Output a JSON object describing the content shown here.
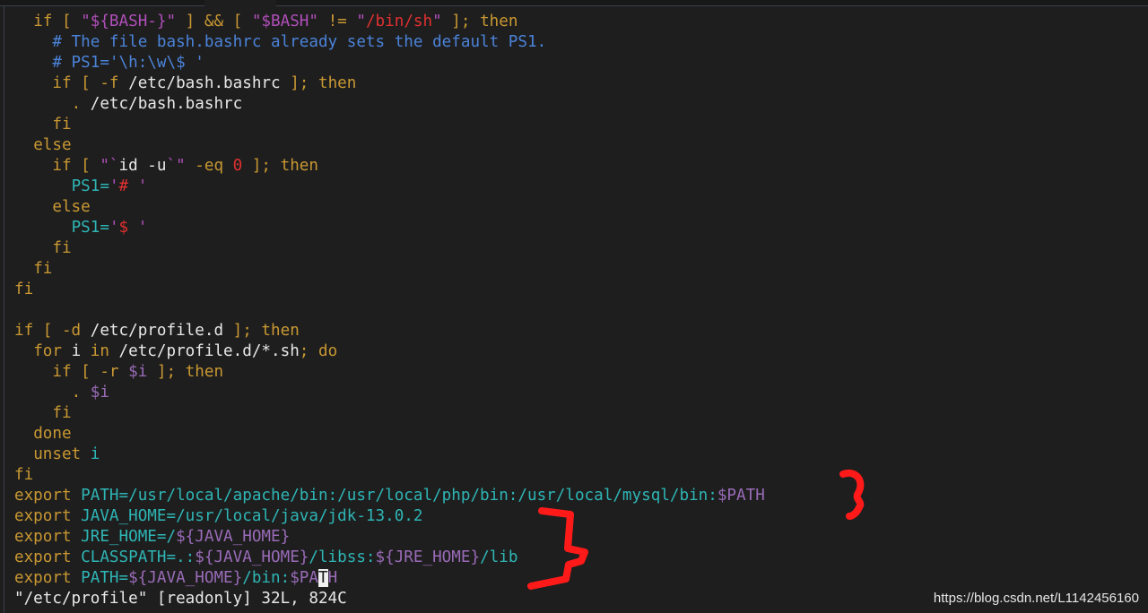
{
  "editor": {
    "lines": [
      [
        {
          "t": "  "
        },
        {
          "c": "kw",
          "t": "if [ "
        },
        {
          "c": "str",
          "t": "\"${BASH-}\""
        },
        {
          "c": "kw",
          "t": " ] && [ "
        },
        {
          "c": "str",
          "t": "\"$BASH\""
        },
        {
          "c": "kw",
          "t": " != "
        },
        {
          "c": "str",
          "t": "\""
        },
        {
          "c": "red",
          "t": "/bin/sh"
        },
        {
          "c": "str",
          "t": "\""
        },
        {
          "c": "kw",
          "t": " ]; then"
        }
      ],
      [
        {
          "t": "    "
        },
        {
          "c": "cmt",
          "t": "# The file bash.bashrc already sets the default PS1."
        }
      ],
      [
        {
          "t": "    "
        },
        {
          "c": "cmt",
          "t": "# PS1='\\h:\\w\\$ '"
        }
      ],
      [
        {
          "t": "    "
        },
        {
          "c": "kw",
          "t": "if [ -f "
        },
        {
          "c": "wh",
          "t": "/etc/bash.bashrc"
        },
        {
          "c": "kw",
          "t": " ]; then"
        }
      ],
      [
        {
          "t": "      "
        },
        {
          "c": "kw",
          "t": ". "
        },
        {
          "c": "wh",
          "t": "/etc/bash.bashrc"
        }
      ],
      [
        {
          "t": "    "
        },
        {
          "c": "kw",
          "t": "fi"
        }
      ],
      [
        {
          "t": "  "
        },
        {
          "c": "kw",
          "t": "else"
        }
      ],
      [
        {
          "t": "    "
        },
        {
          "c": "kw",
          "t": "if [ "
        },
        {
          "c": "str",
          "t": "\"`"
        },
        {
          "c": "wh",
          "t": "id -u"
        },
        {
          "c": "str",
          "t": "`\""
        },
        {
          "c": "kw",
          "t": " -eq "
        },
        {
          "c": "red",
          "t": "0"
        },
        {
          "c": "kw",
          "t": " ]; then"
        }
      ],
      [
        {
          "t": "      "
        },
        {
          "c": "cy",
          "t": "PS1="
        },
        {
          "c": "str",
          "t": "'"
        },
        {
          "c": "red",
          "t": "#"
        },
        {
          "c": "str",
          "t": " '"
        }
      ],
      [
        {
          "t": "    "
        },
        {
          "c": "kw",
          "t": "else"
        }
      ],
      [
        {
          "t": "      "
        },
        {
          "c": "cy",
          "t": "PS1="
        },
        {
          "c": "str",
          "t": "'"
        },
        {
          "c": "red",
          "t": "$"
        },
        {
          "c": "str",
          "t": " '"
        }
      ],
      [
        {
          "t": "    "
        },
        {
          "c": "kw",
          "t": "fi"
        }
      ],
      [
        {
          "t": "  "
        },
        {
          "c": "kw",
          "t": "fi"
        }
      ],
      [
        {
          "c": "kw",
          "t": "fi"
        }
      ],
      [],
      [
        {
          "c": "kw",
          "t": "if [ -d "
        },
        {
          "c": "wh",
          "t": "/etc/profile.d"
        },
        {
          "c": "kw",
          "t": " ]; then"
        }
      ],
      [
        {
          "t": "  "
        },
        {
          "c": "kw",
          "t": "for "
        },
        {
          "c": "wh",
          "t": "i"
        },
        {
          "c": "kw",
          "t": " in "
        },
        {
          "c": "wh",
          "t": "/etc/profile.d/*.sh"
        },
        {
          "c": "kw",
          "t": "; do"
        }
      ],
      [
        {
          "t": "    "
        },
        {
          "c": "kw",
          "t": "if [ -r "
        },
        {
          "c": "var",
          "t": "$i"
        },
        {
          "c": "kw",
          "t": " ]; then"
        }
      ],
      [
        {
          "t": "      "
        },
        {
          "c": "kw",
          "t": ". "
        },
        {
          "c": "var",
          "t": "$i"
        }
      ],
      [
        {
          "t": "    "
        },
        {
          "c": "kw",
          "t": "fi"
        }
      ],
      [
        {
          "t": "  "
        },
        {
          "c": "kw",
          "t": "done"
        }
      ],
      [
        {
          "t": "  "
        },
        {
          "c": "kw",
          "t": "unset "
        },
        {
          "c": "cy",
          "t": "i"
        }
      ],
      [
        {
          "c": "kw",
          "t": "fi"
        }
      ],
      [
        {
          "c": "kw",
          "t": "export "
        },
        {
          "c": "cy",
          "t": "PATH=/usr/local/apache/bin:/usr/local/php/bin:/usr/local/mysql/bin:"
        },
        {
          "c": "var",
          "t": "$PATH"
        }
      ],
      [
        {
          "c": "kw",
          "t": "export "
        },
        {
          "c": "cy",
          "t": "JAVA_HOME=/usr/local/java/jdk-13.0.2"
        }
      ],
      [
        {
          "c": "kw",
          "t": "export "
        },
        {
          "c": "cy",
          "t": "JRE_HOME=/"
        },
        {
          "c": "var",
          "t": "${JAVA_HOME}"
        }
      ],
      [
        {
          "c": "kw",
          "t": "export "
        },
        {
          "c": "cy",
          "t": "CLASSPATH=.:"
        },
        {
          "c": "var",
          "t": "${JAVA_HOME}"
        },
        {
          "c": "cy",
          "t": "/libss:"
        },
        {
          "c": "var",
          "t": "${JRE_HOME}"
        },
        {
          "c": "cy",
          "t": "/lib"
        }
      ],
      [
        {
          "c": "kw",
          "t": "export "
        },
        {
          "c": "cy",
          "t": "PATH="
        },
        {
          "c": "var",
          "t": "${JAVA_HOME}"
        },
        {
          "c": "cy",
          "t": "/bin:"
        },
        {
          "c": "var",
          "t": "$PA"
        },
        {
          "c": "cursor",
          "t": "T"
        },
        {
          "c": "var",
          "t": "H"
        }
      ]
    ],
    "status_line": "\"/etc/profile\" [readonly] 32L, 824C"
  },
  "watermark": "https://blog.csdn.net/L1142456160",
  "colors": {
    "background": "#1e1e1e",
    "keyword": "#c99832",
    "string": "#b04fb9",
    "special": "#e03030",
    "comment": "#4b83d9",
    "variable": "#9a6bb8",
    "identifier": "#2fb5b5",
    "annotation": "#ff1a1a"
  }
}
